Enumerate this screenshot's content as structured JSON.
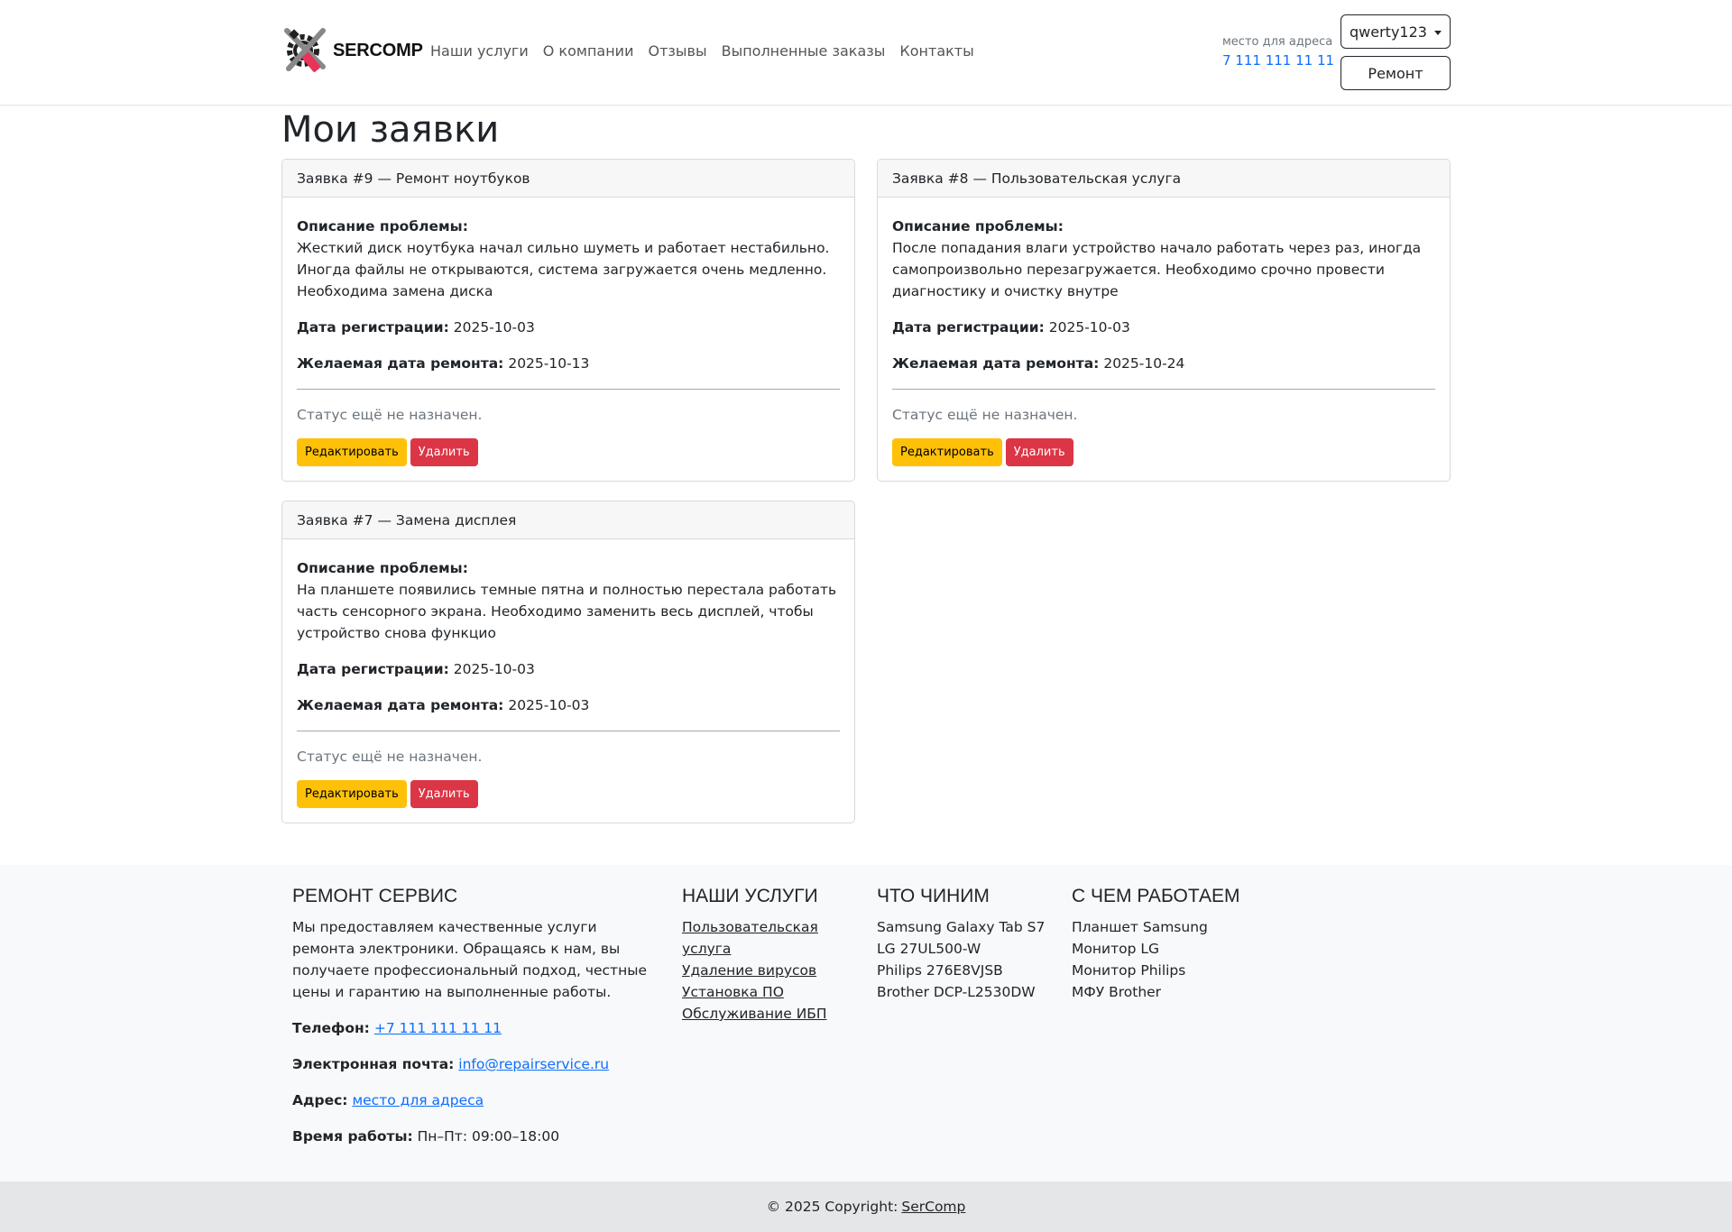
{
  "header": {
    "logo_text": "SERCOMP",
    "nav": [
      "Наши услуги",
      "О компании",
      "Отзывы",
      "Выполненные заказы",
      "Контакты"
    ],
    "address_label": "место для адреса",
    "phone": "7 111 111 11 11",
    "user_button": "qwerty123",
    "repair_button": "Ремонт"
  },
  "page": {
    "title": "Мои заявки"
  },
  "labels": {
    "description": "Описание проблемы:",
    "reg_date": "Дата регистрации:",
    "desired_date": "Желаемая дата ремонта:",
    "edit": "Редактировать",
    "delete": "Удалить"
  },
  "orders": [
    {
      "header": "Заявка #9 — Ремонт ноутбуков",
      "description": "Жесткий диск ноутбука начал сильно шуметь и работает нестабильно. Иногда файлы не открываются, система загружается очень медленно. Необходима замена диска",
      "reg_date": "2025-10-03",
      "desired_date": "2025-10-13",
      "status": "Статус ещё не назначен."
    },
    {
      "header": "Заявка #8 — Пользовательская услуга",
      "description": "После попадания влаги устройство начало работать через раз, иногда самопроизвольно перезагружается. Необходимо срочно провести диагностику и очистку внутре",
      "reg_date": "2025-10-03",
      "desired_date": "2025-10-24",
      "status": "Статус ещё не назначен."
    },
    {
      "header": "Заявка #7 — Замена дисплея",
      "description": "На планшете появились темные пятна и полностью перестала работать часть сенсорного экрана. Необходимо заменить весь дисплей, чтобы устройство снова функцио",
      "reg_date": "2025-10-03",
      "desired_date": "2025-10-03",
      "status": "Статус ещё не назначен."
    }
  ],
  "footer": {
    "about": {
      "title": "РЕМОНТ СЕРВИС",
      "text": "Мы предоставляем качественные услуги ремонта электроники. Обращаясь к нам, вы получаете профессиональный подход, честные цены и гарантию на выполненные работы.",
      "phone_label": "Телефон:",
      "phone": "+7 111 111 11 11",
      "email_label": "Электронная почта:",
      "email": "info@repairservice.ru",
      "address_label": "Адрес:",
      "address": "место для адреса",
      "hours_label": "Время работы:",
      "hours": "Пн–Пт: 09:00–18:00"
    },
    "services": {
      "title": "НАШИ УСЛУГИ",
      "items": [
        "Пользовательская услуга",
        "Удаление вирусов",
        "Установка ПО",
        "Обслуживание ИБП"
      ]
    },
    "repairs": {
      "title": "ЧТО ЧИНИМ",
      "items": [
        "Samsung Galaxy Tab S7",
        "LG 27UL500-W",
        "Philips 276E8VJSB",
        "Brother DCP-L2530DW"
      ]
    },
    "works_with": {
      "title": "С ЧЕМ РАБОТАЕМ",
      "items": [
        "Планшет Samsung",
        "Монитор LG",
        "Монитор Philips",
        "МФУ Brother"
      ]
    },
    "copyright": "© 2025 Copyright:",
    "copyright_link": "SerComp"
  },
  "colors": {
    "primary_link": "#0d6efd",
    "warning": "#ffc107",
    "danger": "#dc3545",
    "logo_accent": "#e8335a"
  },
  "icons": {
    "logo": "gear-wrench-logo-icon",
    "dropdown": "caret-down-icon"
  }
}
